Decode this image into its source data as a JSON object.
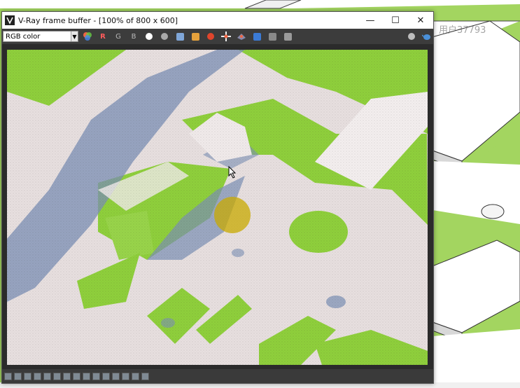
{
  "window": {
    "title": "V-Ray frame buffer - [100% of 800 x 600]",
    "minimize_glyph": "—",
    "maximize_glyph": "☐",
    "close_glyph": "✕"
  },
  "toolbar": {
    "channel_select_value": "RGB color",
    "red_label": "R",
    "green_label": "G",
    "blue_label": "B"
  },
  "watermark": "用户37793",
  "colors": {
    "grass": "#8fcf3c",
    "shadow": "#7b8fb4",
    "slab": "#e7dfdf",
    "window_bg": "#2b2b2b"
  }
}
